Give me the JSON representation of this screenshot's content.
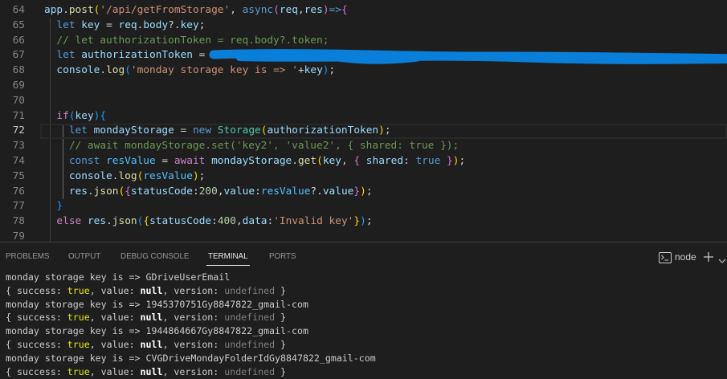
{
  "theme": {
    "editor_bg": "#1e1e1e",
    "panel_bg": "#1e1e1e",
    "panel_border": "#414141",
    "line_number": "#858585",
    "line_number_active": "#c6c6c6",
    "line_highlight_border": "#282828",
    "code_fg": "#d4d4d4",
    "indent_guide": "#404040",
    "indent_guide_active": "#707070",
    "redaction": "#0a7fd9",
    "tab_fg": "#969696",
    "tab_active_fg": "#e7e7e7",
    "tab_active_border": "#e7e7e7",
    "term_fg": "#cccccc"
  },
  "editor": {
    "lines": [
      {
        "number": "64",
        "tokens": [
          {
            "t": "app",
            "c": "#9cdcfe"
          },
          {
            "t": "."
          },
          {
            "t": "post",
            "c": "#dcdcaa"
          },
          {
            "t": "(",
            "c": "#ffd700"
          },
          {
            "t": "'/api/getFromStorage'",
            "c": "#ce9178"
          },
          {
            "t": ", "
          },
          {
            "t": "async",
            "c": "#569cd6"
          },
          {
            "t": "(",
            "c": "#da70d6"
          },
          {
            "t": "req",
            "c": "#9cdcfe"
          },
          {
            "t": ","
          },
          {
            "t": "res",
            "c": "#9cdcfe"
          },
          {
            "t": ")",
            "c": "#da70d6"
          },
          {
            "t": "=>",
            "c": "#569cd6"
          },
          {
            "t": "{",
            "c": "#da70d6"
          }
        ]
      },
      {
        "number": "65",
        "tokens": [
          {
            "t": "  let",
            "c": "#569cd6"
          },
          {
            "t": " "
          },
          {
            "t": "key",
            "c": "#9cdcfe"
          },
          {
            "t": " = "
          },
          {
            "t": "req",
            "c": "#9cdcfe"
          },
          {
            "t": "."
          },
          {
            "t": "body",
            "c": "#9cdcfe"
          },
          {
            "t": "?."
          },
          {
            "t": "key",
            "c": "#9cdcfe"
          },
          {
            "t": ";"
          }
        ]
      },
      {
        "number": "66",
        "tokens": [
          {
            "t": "  // let authorizationToken = req.body?.token;",
            "c": "#6a9955"
          }
        ]
      },
      {
        "number": "67",
        "redacted": true,
        "tokens": [
          {
            "t": "  let",
            "c": "#569cd6"
          },
          {
            "t": " "
          },
          {
            "t": "authorizationToken",
            "c": "#9cdcfe"
          },
          {
            "t": " = "
          }
        ]
      },
      {
        "number": "68",
        "tokens": [
          {
            "t": "  console",
            "c": "#9cdcfe"
          },
          {
            "t": "."
          },
          {
            "t": "log",
            "c": "#dcdcaa"
          },
          {
            "t": "(",
            "c": "#179fff"
          },
          {
            "t": "'monday storage key is => '",
            "c": "#ce9178"
          },
          {
            "t": "+"
          },
          {
            "t": "key",
            "c": "#9cdcfe"
          },
          {
            "t": ")",
            "c": "#179fff"
          },
          {
            "t": ";"
          }
        ]
      },
      {
        "number": "69",
        "tokens": []
      },
      {
        "number": "70",
        "tokens": []
      },
      {
        "number": "71",
        "tokens": [
          {
            "t": "  if",
            "c": "#c586c0"
          },
          {
            "t": "(",
            "c": "#179fff"
          },
          {
            "t": "key",
            "c": "#9cdcfe"
          },
          {
            "t": ")",
            "c": "#179fff"
          },
          {
            "t": "{",
            "c": "#179fff"
          }
        ]
      },
      {
        "number": "72",
        "active": true,
        "tokens": [
          {
            "t": "    let",
            "c": "#569cd6"
          },
          {
            "t": " "
          },
          {
            "t": "mondayStorage",
            "c": "#9cdcfe"
          },
          {
            "t": " = "
          },
          {
            "t": "new",
            "c": "#569cd6"
          },
          {
            "t": " "
          },
          {
            "t": "Storage",
            "c": "#4ec9b0"
          },
          {
            "t": "(",
            "c": "#ffd700"
          },
          {
            "t": "authorizationToken",
            "c": "#9cdcfe"
          },
          {
            "t": ")",
            "c": "#ffd700"
          },
          {
            "t": ";"
          }
        ]
      },
      {
        "number": "73",
        "tokens": [
          {
            "t": "    // await mondayStorage.set('key2', 'value2', { shared: true });",
            "c": "#6a9955"
          }
        ]
      },
      {
        "number": "74",
        "tokens": [
          {
            "t": "    const",
            "c": "#569cd6"
          },
          {
            "t": " "
          },
          {
            "t": "resValue",
            "c": "#4fc1ff"
          },
          {
            "t": " = "
          },
          {
            "t": "await",
            "c": "#c586c0"
          },
          {
            "t": " "
          },
          {
            "t": "mondayStorage",
            "c": "#9cdcfe"
          },
          {
            "t": "."
          },
          {
            "t": "get",
            "c": "#dcdcaa"
          },
          {
            "t": "(",
            "c": "#ffd700"
          },
          {
            "t": "key",
            "c": "#9cdcfe"
          },
          {
            "t": ", "
          },
          {
            "t": "{",
            "c": "#da70d6"
          },
          {
            "t": " "
          },
          {
            "t": "shared",
            "c": "#9cdcfe"
          },
          {
            "t": ": "
          },
          {
            "t": "true",
            "c": "#569cd6"
          },
          {
            "t": " "
          },
          {
            "t": "}",
            "c": "#da70d6"
          },
          {
            "t": ")",
            "c": "#ffd700"
          },
          {
            "t": ";"
          }
        ]
      },
      {
        "number": "75",
        "tokens": [
          {
            "t": "    console",
            "c": "#9cdcfe"
          },
          {
            "t": "."
          },
          {
            "t": "log",
            "c": "#dcdcaa"
          },
          {
            "t": "(",
            "c": "#ffd700"
          },
          {
            "t": "resValue",
            "c": "#4fc1ff"
          },
          {
            "t": ")",
            "c": "#ffd700"
          },
          {
            "t": ";"
          }
        ]
      },
      {
        "number": "76",
        "tokens": [
          {
            "t": "    res",
            "c": "#9cdcfe"
          },
          {
            "t": "."
          },
          {
            "t": "json",
            "c": "#dcdcaa"
          },
          {
            "t": "(",
            "c": "#ffd700"
          },
          {
            "t": "{",
            "c": "#da70d6"
          },
          {
            "t": "statusCode",
            "c": "#9cdcfe"
          },
          {
            "t": ":"
          },
          {
            "t": "200",
            "c": "#b5cea8"
          },
          {
            "t": ","
          },
          {
            "t": "value",
            "c": "#9cdcfe"
          },
          {
            "t": ":"
          },
          {
            "t": "resValue",
            "c": "#4fc1ff"
          },
          {
            "t": "?."
          },
          {
            "t": "value",
            "c": "#9cdcfe"
          },
          {
            "t": "}",
            "c": "#da70d6"
          },
          {
            "t": ")",
            "c": "#ffd700"
          },
          {
            "t": ";"
          }
        ]
      },
      {
        "number": "77",
        "tokens": [
          {
            "t": "  }",
            "c": "#179fff"
          }
        ]
      },
      {
        "number": "78",
        "tokens": [
          {
            "t": "  else",
            "c": "#c586c0"
          },
          {
            "t": " "
          },
          {
            "t": "res",
            "c": "#9cdcfe"
          },
          {
            "t": "."
          },
          {
            "t": "json",
            "c": "#dcdcaa"
          },
          {
            "t": "(",
            "c": "#179fff"
          },
          {
            "t": "{",
            "c": "#ffd700"
          },
          {
            "t": "statusCode",
            "c": "#9cdcfe"
          },
          {
            "t": ":"
          },
          {
            "t": "400",
            "c": "#b5cea8"
          },
          {
            "t": ","
          },
          {
            "t": "data",
            "c": "#9cdcfe"
          },
          {
            "t": ":"
          },
          {
            "t": "'Invalid key'",
            "c": "#ce9178"
          },
          {
            "t": "}",
            "c": "#ffd700"
          },
          {
            "t": ")",
            "c": "#179fff"
          },
          {
            "t": ";"
          }
        ]
      },
      {
        "number": "79",
        "tokens": []
      }
    ]
  },
  "panel": {
    "tabs": [
      {
        "label": "PROBLEMS"
      },
      {
        "label": "OUTPUT"
      },
      {
        "label": "DEBUG CONSOLE"
      },
      {
        "label": "TERMINAL",
        "active": true
      },
      {
        "label": "PORTS"
      }
    ],
    "terminal_icon": "terminal-icon",
    "terminal_name": "node",
    "new_terminal_icon": "plus-icon",
    "dropdown_icon": "chevron-down-icon"
  },
  "terminal": {
    "lines": [
      {
        "tokens": [
          {
            "t": "monday storage key is => GDriveUserEmail"
          }
        ]
      },
      {
        "tokens": [
          {
            "t": "{ success: "
          },
          {
            "t": "true",
            "c": "#e5e510"
          },
          {
            "t": ", value: "
          },
          {
            "t": "null",
            "c": "#ffffff",
            "b": true
          },
          {
            "t": ", version: "
          },
          {
            "t": "undefined",
            "c": "#808080"
          },
          {
            "t": " }"
          }
        ]
      },
      {
        "tokens": [
          {
            "t": "monday storage key is => 1945370751Gy8847822_gmail-com"
          }
        ]
      },
      {
        "tokens": [
          {
            "t": "{ success: "
          },
          {
            "t": "true",
            "c": "#e5e510"
          },
          {
            "t": ", value: "
          },
          {
            "t": "null",
            "c": "#ffffff",
            "b": true
          },
          {
            "t": ", version: "
          },
          {
            "t": "undefined",
            "c": "#808080"
          },
          {
            "t": " }"
          }
        ]
      },
      {
        "tokens": [
          {
            "t": "monday storage key is => 1944864667Gy8847822_gmail-com"
          }
        ]
      },
      {
        "tokens": [
          {
            "t": "{ success: "
          },
          {
            "t": "true",
            "c": "#e5e510"
          },
          {
            "t": ", value: "
          },
          {
            "t": "null",
            "c": "#ffffff",
            "b": true
          },
          {
            "t": ", version: "
          },
          {
            "t": "undefined",
            "c": "#808080"
          },
          {
            "t": " }"
          }
        ]
      },
      {
        "tokens": [
          {
            "t": "monday storage key is => CVGDriveMondayFolderIdGy8847822_gmail-com"
          }
        ]
      },
      {
        "tokens": [
          {
            "t": "{ success: "
          },
          {
            "t": "true",
            "c": "#e5e510"
          },
          {
            "t": ", value: "
          },
          {
            "t": "null",
            "c": "#ffffff",
            "b": true
          },
          {
            "t": ", version: "
          },
          {
            "t": "undefined",
            "c": "#808080"
          },
          {
            "t": " }"
          }
        ]
      }
    ]
  }
}
